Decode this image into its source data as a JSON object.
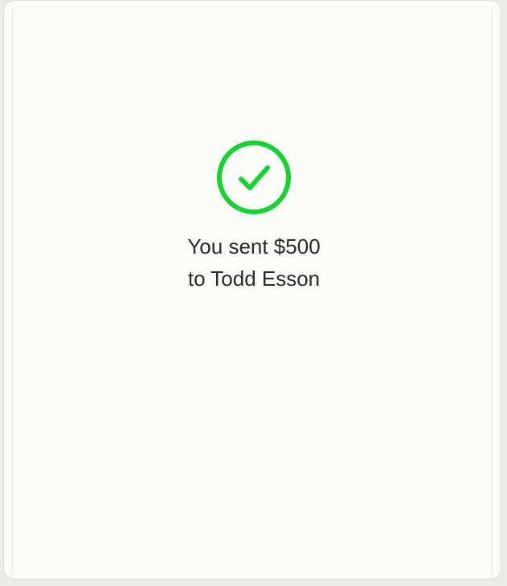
{
  "confirmation": {
    "status_icon": "check-circle-icon",
    "accent_color": "#15d430",
    "line1": "You sent $500",
    "line2": "to Todd Esson"
  }
}
